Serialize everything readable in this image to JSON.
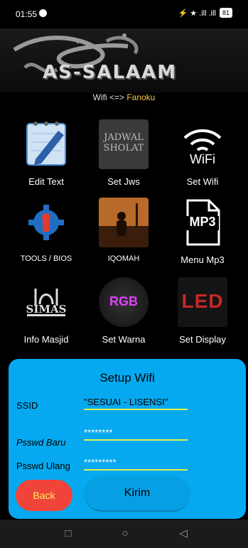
{
  "status": {
    "time": "01:55",
    "battery": "81",
    "signal_text": "⚡ ★ .ill .ill"
  },
  "banner": {
    "title": "AS-SALAAM"
  },
  "subtitle": {
    "prefix": "Wifi <=> ",
    "network": "Fanoku"
  },
  "tiles": [
    {
      "label": "Edit Text",
      "icon": "notebook-pencil-icon",
      "art": ""
    },
    {
      "label": "Set Jws",
      "icon": "jadwal-sholat-icon",
      "art": "JADWAL\nSHOLAT"
    },
    {
      "label": "Set Wifi",
      "icon": "wifi-icon",
      "art": "WiFi"
    },
    {
      "label": "TOOLS / BIOS",
      "icon": "tools-gear-icon",
      "art": ""
    },
    {
      "label": "IQOMAH",
      "icon": "prayer-silhouette-icon",
      "art": ""
    },
    {
      "label": "Menu Mp3",
      "icon": "mp3-file-icon",
      "art": "MP3"
    },
    {
      "label": "Info Masjid",
      "icon": "simas-logo-icon",
      "art": "SIMAS"
    },
    {
      "label": "Set Warna",
      "icon": "rgb-led-icon",
      "art": "RGB"
    },
    {
      "label": "Set Display",
      "icon": "led-display-icon",
      "art": "LED"
    }
  ],
  "dialog": {
    "title": "Setup Wifi",
    "ssid_label": "SSID",
    "ssid_value": "\"SESUAI - LISENSI\"",
    "pass_new_label": "Psswd Baru",
    "pass_new_value": "********",
    "pass_repeat_label": "Psswd Ulang",
    "pass_repeat_value": "*********",
    "back_label": "Back",
    "send_label": "Kirim"
  },
  "nav": {
    "recent": "□",
    "home": "○",
    "back": "◁"
  }
}
